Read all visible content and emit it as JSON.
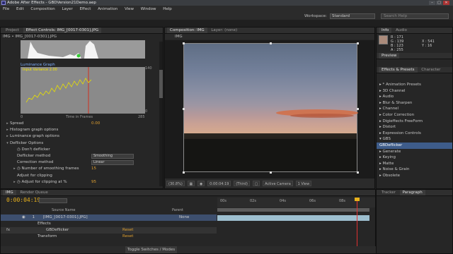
{
  "app": {
    "title": "Adobe After Effects - GBDVersion21Demo.aep",
    "workspace_label": "Workspace:",
    "workspace_value": "Standard",
    "search_placeholder": "Search Help"
  },
  "menu": [
    "File",
    "Edit",
    "Composition",
    "Layer",
    "Effect",
    "Animation",
    "View",
    "Window",
    "Help"
  ],
  "left_panel": {
    "tabs": [
      "Project",
      "Effect Controls: IMG_[0017-0301].JPG"
    ],
    "header": "IMG • IMG_[0017-0301].JPG",
    "lum_title": "Luminance Graph",
    "graph_label": "Input Variance 2.00",
    "y_max": "140",
    "y_min": "0",
    "x_start": "0",
    "x_label": "Time in Frames",
    "x_end": "285",
    "props": [
      {
        "tri": "▸",
        "label": "Spread",
        "value": "0.00",
        "indent": 6
      },
      {
        "tri": "▸",
        "label": "Histogram graph options",
        "value": "",
        "indent": 6
      },
      {
        "tri": "▸",
        "label": "Luminance graph options",
        "value": "",
        "indent": 6
      },
      {
        "tri": "▾",
        "label": "Deflicker Options",
        "value": "",
        "indent": 6
      },
      {
        "tri": "",
        "label": "◷ Don't deflicker",
        "value": "",
        "indent": 16
      },
      {
        "tri": "",
        "label": "Deflicker method",
        "value": "",
        "indent": 16
      },
      {
        "tri": "",
        "label": "Correction method",
        "value": "",
        "indent": 16
      },
      {
        "tri": "▸",
        "label": "◷ Number of smoothing frames",
        "value": "15",
        "indent": 16
      },
      {
        "tri": "",
        "label": "Adjust for clipping",
        "value": "",
        "indent": 16
      },
      {
        "tri": "▸",
        "label": "◷ Adjust for clipping at %",
        "value": "95",
        "indent": 16
      }
    ],
    "deflicker_method": "Smoothing",
    "correction_method": "Linear"
  },
  "comp_panel": {
    "tabs": [
      "Composition: IMG",
      "Layer: (none)"
    ],
    "sub": "IMG",
    "toolbar": [
      "(30.8%)",
      "0:00:04:19",
      "(Third)",
      "Active Camera",
      "1 View"
    ]
  },
  "right_panel": {
    "tabs": [
      "Info",
      "Audio"
    ],
    "r": "R : 171",
    "g": "G : 139",
    "b": "B : 123",
    "a": "A : 255",
    "x": "X : 541",
    "y": "Y : 16",
    "preview_tab": "Preview",
    "effects_tabs": [
      "Effects & Presets",
      "Character"
    ],
    "effects": [
      {
        "label": "▸ * Animation Presets",
        "sel": false
      },
      {
        "label": "▸ 3D Channel",
        "sel": false
      },
      {
        "label": "▸ Audio",
        "sel": false
      },
      {
        "label": "▸ Blur & Sharpen",
        "sel": false
      },
      {
        "label": "▸ Channel",
        "sel": false
      },
      {
        "label": "▸ Color Correction",
        "sel": false
      },
      {
        "label": "▸ Digieffects FreeForm",
        "sel": false
      },
      {
        "label": "▸ Distort",
        "sel": false
      },
      {
        "label": "▸ Expression Controls",
        "sel": false
      },
      {
        "label": "▾ GBS",
        "sel": false
      },
      {
        "label": "    GBDeflicker",
        "sel": true
      },
      {
        "label": "▸ Generate",
        "sel": false
      },
      {
        "label": "▸ Keying",
        "sel": false
      },
      {
        "label": "▸ Matte",
        "sel": false
      },
      {
        "label": "▸ Noise & Grain",
        "sel": false
      },
      {
        "label": "▸ Obsolete",
        "sel": false
      }
    ],
    "bottom_tabs": [
      "Tracker",
      "Paragraph"
    ]
  },
  "timeline": {
    "tabs": [
      "IMG",
      "Render Queue"
    ],
    "timecode": "0:00:04:19",
    "cols": {
      "source": "Source Name",
      "parent": "Parent"
    },
    "layer": {
      "num": "1",
      "name": "[IMG_[0017-0301].JPG]",
      "parent": "None"
    },
    "rows": [
      "Effects",
      "GBDeflicker",
      "Transform"
    ],
    "reset": "Reset",
    "ticks": [
      "00s",
      "02s",
      "04s",
      "06s",
      "08s"
    ],
    "toggle_label": "Toggle Switches / Modes"
  }
}
